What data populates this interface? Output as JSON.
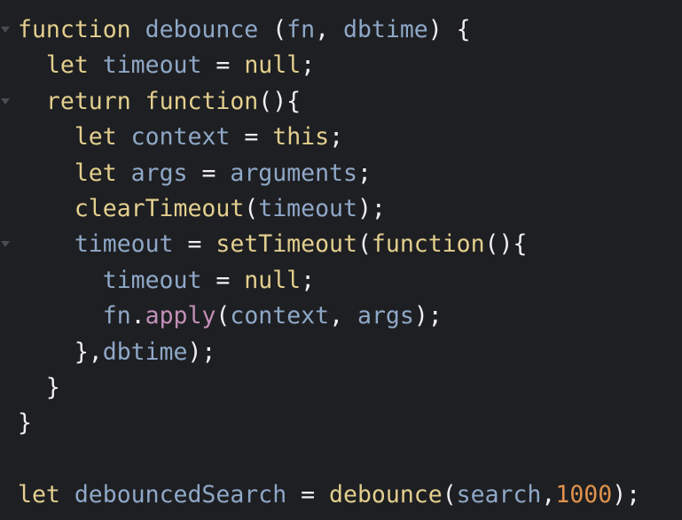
{
  "editor": {
    "lines": [
      {
        "fold": true,
        "tokens": [
          {
            "t": "function",
            "c": "kw"
          },
          {
            "t": " ",
            "c": "punc"
          },
          {
            "t": "debounce",
            "c": "ident"
          },
          {
            "t": " (",
            "c": "punc"
          },
          {
            "t": "fn",
            "c": "ident"
          },
          {
            "t": ", ",
            "c": "punc"
          },
          {
            "t": "dbtime",
            "c": "ident"
          },
          {
            "t": ") {",
            "c": "punc"
          }
        ]
      },
      {
        "fold": false,
        "tokens": [
          {
            "t": "  ",
            "c": "punc"
          },
          {
            "t": "let",
            "c": "kw"
          },
          {
            "t": " ",
            "c": "punc"
          },
          {
            "t": "timeout",
            "c": "ident"
          },
          {
            "t": " = ",
            "c": "punc"
          },
          {
            "t": "null",
            "c": "kw"
          },
          {
            "t": ";",
            "c": "punc"
          }
        ]
      },
      {
        "fold": true,
        "tokens": [
          {
            "t": "  ",
            "c": "punc"
          },
          {
            "t": "return",
            "c": "kw"
          },
          {
            "t": " ",
            "c": "punc"
          },
          {
            "t": "function",
            "c": "kw"
          },
          {
            "t": "(){",
            "c": "punc"
          }
        ]
      },
      {
        "fold": false,
        "tokens": [
          {
            "t": "    ",
            "c": "punc"
          },
          {
            "t": "let",
            "c": "kw"
          },
          {
            "t": " ",
            "c": "punc"
          },
          {
            "t": "context",
            "c": "ident"
          },
          {
            "t": " = ",
            "c": "punc"
          },
          {
            "t": "this",
            "c": "kw"
          },
          {
            "t": ";",
            "c": "punc"
          }
        ]
      },
      {
        "fold": false,
        "tokens": [
          {
            "t": "    ",
            "c": "punc"
          },
          {
            "t": "let",
            "c": "kw"
          },
          {
            "t": " ",
            "c": "punc"
          },
          {
            "t": "args",
            "c": "ident"
          },
          {
            "t": " = ",
            "c": "punc"
          },
          {
            "t": "arguments",
            "c": "ident"
          },
          {
            "t": ";",
            "c": "punc"
          }
        ]
      },
      {
        "fold": false,
        "tokens": [
          {
            "t": "    ",
            "c": "punc"
          },
          {
            "t": "clearTimeout",
            "c": "fn"
          },
          {
            "t": "(",
            "c": "punc"
          },
          {
            "t": "timeout",
            "c": "ident"
          },
          {
            "t": ");",
            "c": "punc"
          }
        ]
      },
      {
        "fold": true,
        "tokens": [
          {
            "t": "    ",
            "c": "punc"
          },
          {
            "t": "timeout",
            "c": "ident"
          },
          {
            "t": " = ",
            "c": "punc"
          },
          {
            "t": "setTimeout",
            "c": "fn"
          },
          {
            "t": "(",
            "c": "punc"
          },
          {
            "t": "function",
            "c": "kw"
          },
          {
            "t": "(){",
            "c": "punc"
          }
        ]
      },
      {
        "fold": false,
        "tokens": [
          {
            "t": "      ",
            "c": "punc"
          },
          {
            "t": "timeout",
            "c": "ident"
          },
          {
            "t": " = ",
            "c": "punc"
          },
          {
            "t": "null",
            "c": "kw"
          },
          {
            "t": ";",
            "c": "punc"
          }
        ]
      },
      {
        "fold": false,
        "tokens": [
          {
            "t": "      ",
            "c": "punc"
          },
          {
            "t": "fn",
            "c": "ident"
          },
          {
            "t": ".",
            "c": "punc"
          },
          {
            "t": "apply",
            "c": "method"
          },
          {
            "t": "(",
            "c": "punc"
          },
          {
            "t": "context",
            "c": "ident"
          },
          {
            "t": ", ",
            "c": "punc"
          },
          {
            "t": "args",
            "c": "ident"
          },
          {
            "t": ");",
            "c": "punc"
          }
        ]
      },
      {
        "fold": false,
        "tokens": [
          {
            "t": "    },",
            "c": "punc"
          },
          {
            "t": "dbtime",
            "c": "ident"
          },
          {
            "t": ");",
            "c": "punc"
          }
        ]
      },
      {
        "fold": false,
        "tokens": [
          {
            "t": "  }",
            "c": "punc"
          }
        ]
      },
      {
        "fold": false,
        "tokens": [
          {
            "t": "}",
            "c": "punc"
          }
        ]
      },
      {
        "fold": false,
        "tokens": []
      },
      {
        "fold": false,
        "tokens": [
          {
            "t": "let",
            "c": "kw"
          },
          {
            "t": " ",
            "c": "punc"
          },
          {
            "t": "debouncedSearch",
            "c": "ident"
          },
          {
            "t": " = ",
            "c": "punc"
          },
          {
            "t": "debounce",
            "c": "fn"
          },
          {
            "t": "(",
            "c": "punc"
          },
          {
            "t": "search",
            "c": "ident"
          },
          {
            "t": ",",
            "c": "punc"
          },
          {
            "t": "1000",
            "c": "num"
          },
          {
            "t": ");",
            "c": "punc"
          }
        ]
      }
    ]
  },
  "colors": {
    "background": "#1e1f22",
    "keyword": "#e3cf8e",
    "identifier": "#8fa8c8",
    "punctuation": "#f0f0f0",
    "method": "#c290b8",
    "number": "#e0924c"
  }
}
